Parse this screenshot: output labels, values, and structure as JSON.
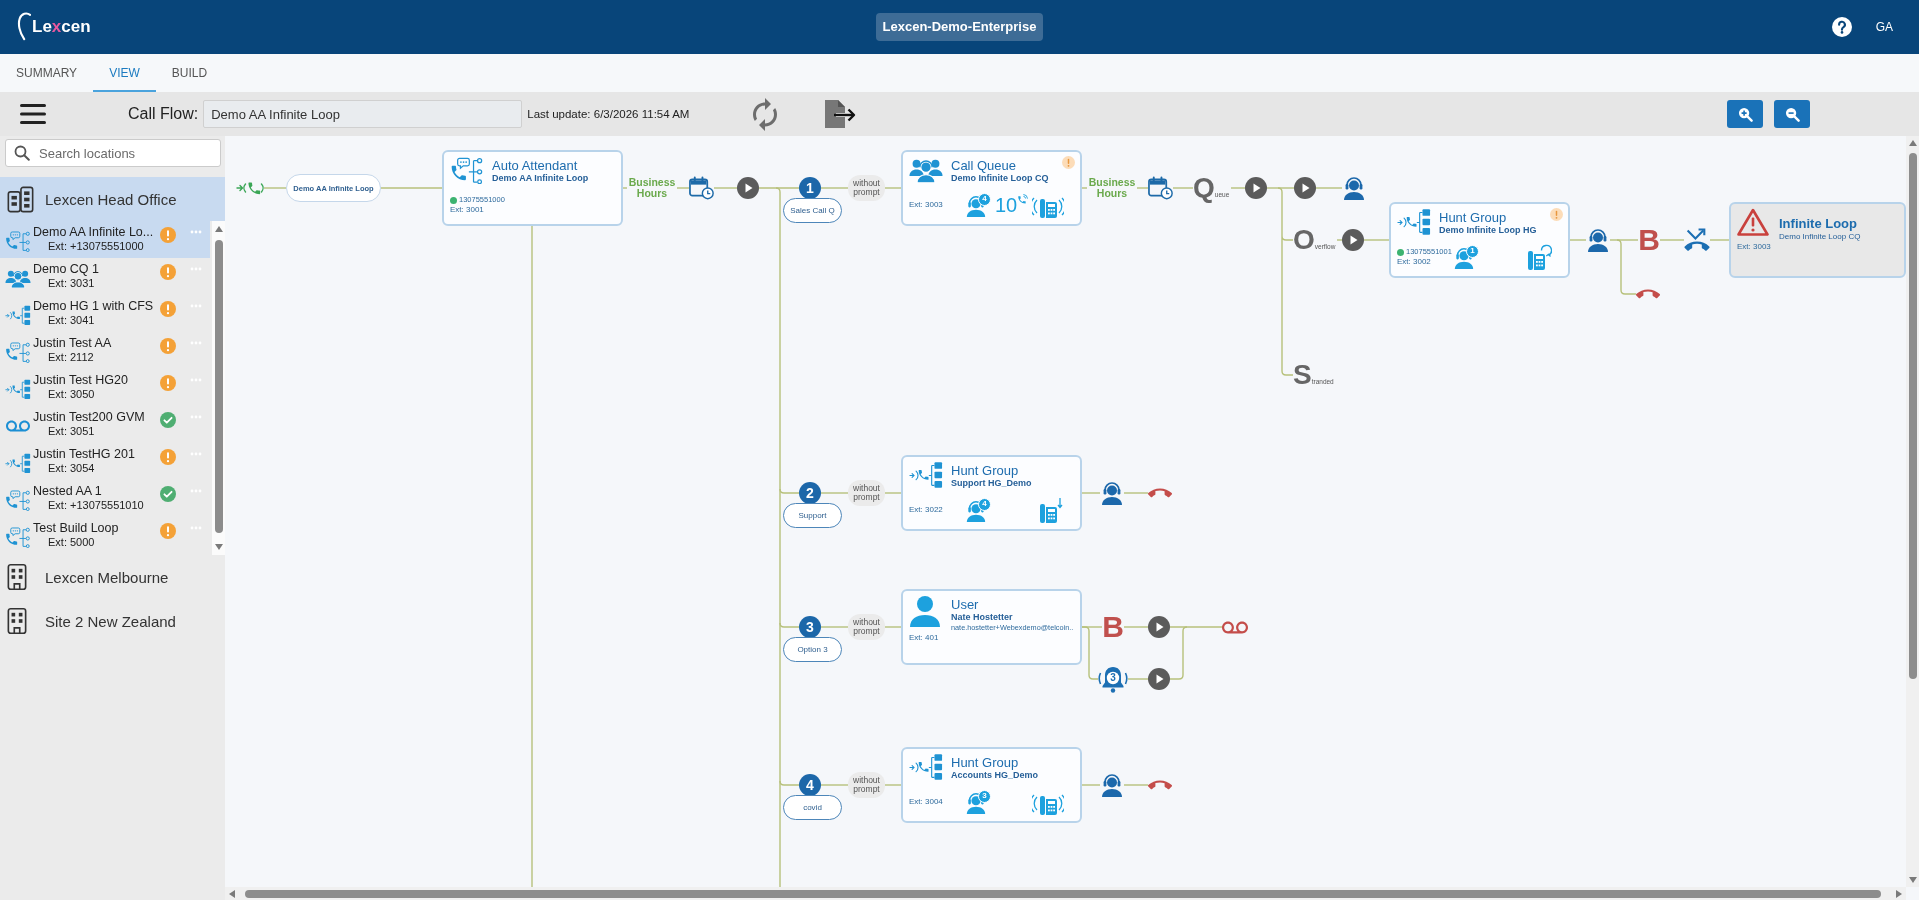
{
  "header": {
    "logo": "Lexcen",
    "title": "Lexcen-Demo-Enterprise",
    "user_initials": "GA"
  },
  "tabs": [
    {
      "label": "SUMMARY",
      "selected": false
    },
    {
      "label": "VIEW",
      "selected": true
    },
    {
      "label": "BUILD",
      "selected": false
    }
  ],
  "toolbar": {
    "label": "Call Flow:",
    "call_flow": "Demo AA Infinite Loop",
    "last_update": "Last update: 6/3/2026 11:54 AM"
  },
  "sidebar": {
    "search": {
      "placeholder": "Search locations"
    },
    "locations": [
      {
        "name": "Lexcen Head Office",
        "selected": true,
        "expanded": true,
        "children": [
          {
            "name": "Demo AA Infinite Lo...",
            "ext": "Ext: +13075551000",
            "kind": "auto_attendant",
            "warning": true,
            "selected": true
          },
          {
            "name": "Demo CQ 1",
            "ext": "Ext: 3031",
            "kind": "call_queue",
            "warning": true,
            "selected": false
          },
          {
            "name": "Demo HG 1 with CFS",
            "ext": "Ext: 3041",
            "kind": "hunt_group",
            "warning": true,
            "selected": false
          },
          {
            "name": "Justin Test AA",
            "ext": "Ext: 2112",
            "kind": "auto_attendant",
            "warning": true,
            "selected": false
          },
          {
            "name": "Justin Test HG20",
            "ext": "Ext: 3050",
            "kind": "hunt_group",
            "warning": true,
            "selected": false
          },
          {
            "name": "Justin Test200 GVM",
            "ext": "Ext: 3051",
            "kind": "voicemail",
            "warning": false,
            "selected": false
          },
          {
            "name": "Justin TestHG 201",
            "ext": "Ext: 3054",
            "kind": "hunt_group",
            "warning": true,
            "selected": false
          },
          {
            "name": "Nested AA 1",
            "ext": "Ext: +13075551010",
            "kind": "auto_attendant",
            "warning": false,
            "selected": false
          },
          {
            "name": "Test Build Loop",
            "ext": "Ext: 5000",
            "kind": "auto_attendant",
            "warning": true,
            "selected": false
          }
        ]
      },
      {
        "name": "Lexcen Melbourne",
        "selected": false,
        "expanded": false
      },
      {
        "name": "Site 2 New Zealand",
        "selected": false,
        "expanded": false
      }
    ]
  },
  "call_flow": {
    "entry": {
      "label": "Demo AA Infinite Loop"
    },
    "auto_attendant": {
      "kind": "auto_attendant",
      "title": "Auto Attendant",
      "name": "Demo AA Infinite Loop",
      "number": "13075551000",
      "number_active": true,
      "ext": "Ext: 3001",
      "warning": false
    },
    "schedule": "Business Hours",
    "options": [
      {
        "key": "1",
        "prompt": "without prompt",
        "label": "Sales Call Q",
        "target": {
          "kind": "call_queue",
          "title": "Call Queue",
          "name": "Demo Infinite Loop CQ",
          "ext": "Ext: 3003",
          "warning": true,
          "agents": "4",
          "queued": "10",
          "phone": {
            "kind": "simultaneous"
          }
        },
        "schedule": "Business Hours",
        "queue": "Queue",
        "answered": [
          {
            "kind": "play"
          },
          {
            "kind": "agent"
          }
        ],
        "overflow": {
          "label": "Overflow",
          "target": {
            "kind": "hunt_group",
            "title": "Hunt Group",
            "name": "Demo Infinite Loop HG",
            "number": "13075551001",
            "number_active": true,
            "ext": "Ext: 3002",
            "warning": true,
            "agents": "1",
            "phone": {
              "kind": "circular"
            }
          },
          "busy": "B",
          "forward": {
            "kind": "error",
            "title": "Infinite Loop",
            "name": "Demo Infinite Loop CQ",
            "ext": "Ext: 3003"
          }
        },
        "stranded": "Stranded"
      },
      {
        "key": "2",
        "prompt": "without prompt",
        "label": "Support",
        "target": {
          "kind": "hunt_group",
          "title": "Hunt Group",
          "name": "Support HG_Demo",
          "ext": "Ext: 3022",
          "warning": false,
          "agents": "4",
          "phone": {
            "kind": "top_down"
          }
        },
        "after": [
          {
            "kind": "agent"
          },
          {
            "kind": "hangup"
          }
        ]
      },
      {
        "key": "3",
        "prompt": "without prompt",
        "label": "Option 3",
        "target": {
          "kind": "user",
          "title": "User",
          "name": "Nate Hostetter",
          "email": "nate.hostetter+Webexdemo@telcoin..",
          "ext": "Ext: 401",
          "warning": false
        },
        "busy": "B",
        "rings": "3"
      },
      {
        "key": "4",
        "prompt": "without prompt",
        "label": "covid",
        "target": {
          "kind": "hunt_group",
          "title": "Hunt Group",
          "name": "Accounts HG_Demo",
          "ext": "Ext: 3004",
          "warning": false,
          "agents": "3",
          "phone": {
            "kind": "simultaneous"
          }
        },
        "after": [
          {
            "kind": "agent"
          },
          {
            "kind": "hangup"
          }
        ]
      }
    ]
  }
}
